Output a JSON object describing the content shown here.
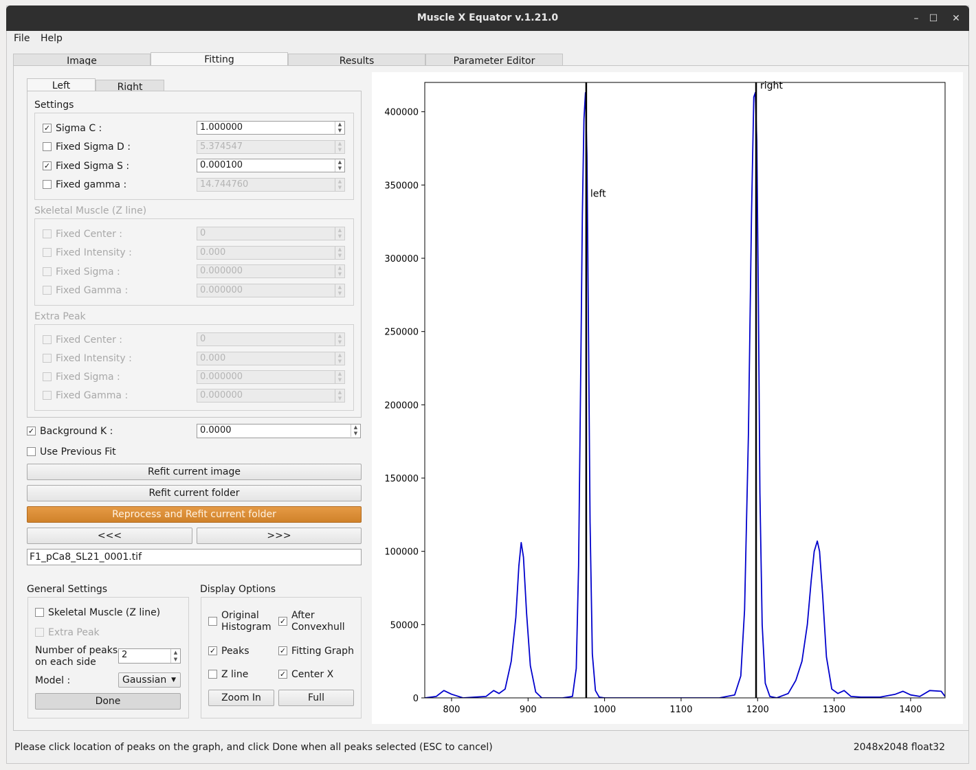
{
  "window": {
    "title": "Muscle X Equator v.1.21.0",
    "minimize": "–",
    "maximize": "☐",
    "close": "✕"
  },
  "menu": {
    "file": "File",
    "help": "Help"
  },
  "tabs": [
    "Image",
    "Fitting",
    "Results",
    "Parameter Editor"
  ],
  "subtabs": [
    "Left",
    "Right"
  ],
  "settings": {
    "title": "Settings",
    "rows": [
      {
        "label": "Sigma C :",
        "checked": true,
        "value": "1.000000",
        "enabled": true
      },
      {
        "label": "Fixed Sigma D :",
        "checked": false,
        "value": "5.374547",
        "enabled": false
      },
      {
        "label": "Fixed Sigma S :",
        "checked": true,
        "value": "0.000100",
        "enabled": true
      },
      {
        "label": "Fixed gamma :",
        "checked": false,
        "value": "14.744760",
        "enabled": false
      }
    ]
  },
  "skeletal": {
    "title": "Skeletal Muscle (Z line)",
    "rows": [
      {
        "label": "Fixed Center :",
        "value": "0"
      },
      {
        "label": "Fixed Intensity :",
        "value": "0.000"
      },
      {
        "label": "Fixed Sigma :",
        "value": "0.000000"
      },
      {
        "label": "Fixed Gamma :",
        "value": "0.000000"
      }
    ]
  },
  "extra_peak": {
    "title": "Extra Peak",
    "rows": [
      {
        "label": "Fixed Center :",
        "value": "0"
      },
      {
        "label": "Fixed Intensity :",
        "value": "0.000"
      },
      {
        "label": "Fixed Sigma :",
        "value": "0.000000"
      },
      {
        "label": "Fixed Gamma :",
        "value": "0.000000"
      }
    ]
  },
  "background_k": {
    "label": "Background K :",
    "checked": true,
    "value": "0.0000"
  },
  "use_previous_fit": {
    "label": "Use Previous Fit",
    "checked": false
  },
  "buttons": {
    "refit_image": "Refit current image",
    "refit_folder": "Refit current folder",
    "reprocess": "Reprocess and Refit current folder",
    "prev": "<<<",
    "next": ">>>"
  },
  "filename": "F1_pCa8_SL21_0001.tif",
  "general": {
    "title": "General Settings",
    "skeletal_label": "Skeletal Muscle (Z line)",
    "extra_peak_label": "Extra Peak",
    "num_peaks_label_1": "Number of peaks",
    "num_peaks_label_2": "on each side",
    "num_peaks_value": "2",
    "model_label": "Model :",
    "model_value": "Gaussian",
    "done": "Done"
  },
  "display": {
    "title": "Display Options",
    "original_1": "Original",
    "original_2": "Histogram",
    "after_1": "After",
    "after_2": "Convexhull",
    "peaks": "Peaks",
    "fitting_graph": "Fitting Graph",
    "z_line": "Z line",
    "center_x": "Center X",
    "zoom_in": "Zoom In",
    "full": "Full",
    "checks": {
      "original": false,
      "after": true,
      "peaks": true,
      "fitting_graph": true,
      "z_line": false,
      "center_x": true
    }
  },
  "status": {
    "message": "Please click location of peaks on the graph, and click Done when all peaks selected (ESC to cancel)",
    "image_info": "2048x2048 float32"
  },
  "chart_data": {
    "type": "line",
    "xlim": [
      765,
      1445
    ],
    "ylim": [
      0,
      420000
    ],
    "xticks": [
      800,
      900,
      1000,
      1100,
      1200,
      1300,
      1400
    ],
    "yticks": [
      0,
      50000,
      100000,
      150000,
      200000,
      250000,
      300000,
      350000,
      400000
    ],
    "line_color": "#0000cc",
    "series": [
      {
        "x": [
          765,
          780,
          790,
          800,
          815,
          830,
          845,
          855,
          862,
          870,
          878,
          884,
          888,
          891,
          894,
          898,
          903,
          910,
          918,
          928,
          945,
          958,
          963,
          966,
          969,
          971,
          973,
          975,
          977,
          979,
          981,
          984,
          988,
          993,
          1000,
          1050,
          1100,
          1150,
          1160,
          1170,
          1178,
          1183,
          1188,
          1192,
          1195,
          1197,
          1199,
          1201,
          1203,
          1206,
          1210,
          1216,
          1225,
          1240,
          1250,
          1258,
          1265,
          1270,
          1274,
          1278,
          1281,
          1285,
          1290,
          1297,
          1305,
          1313,
          1322,
          1335,
          1360,
          1380,
          1390,
          1400,
          1412,
          1425,
          1440,
          1445
        ],
        "y": [
          0,
          1000,
          5000,
          2500,
          0,
          500,
          1000,
          5000,
          3000,
          6000,
          25000,
          55000,
          90000,
          106000,
          96000,
          58000,
          22000,
          4000,
          0,
          0,
          0,
          1000,
          20000,
          90000,
          230000,
          330000,
          395000,
          413000,
          370000,
          250000,
          120000,
          30000,
          5000,
          500,
          0,
          0,
          0,
          0,
          1000,
          2000,
          15000,
          60000,
          180000,
          330000,
          410000,
          413000,
          380000,
          270000,
          140000,
          50000,
          10000,
          1000,
          0,
          3000,
          12000,
          25000,
          50000,
          80000,
          100000,
          107000,
          100000,
          70000,
          28000,
          6000,
          3000,
          5000,
          1000,
          500,
          500,
          2500,
          4500,
          2000,
          1000,
          5000,
          4500,
          1000
        ]
      }
    ],
    "vlines": [
      {
        "x": 976,
        "label": "left"
      },
      {
        "x": 1198,
        "label": "right"
      }
    ]
  }
}
